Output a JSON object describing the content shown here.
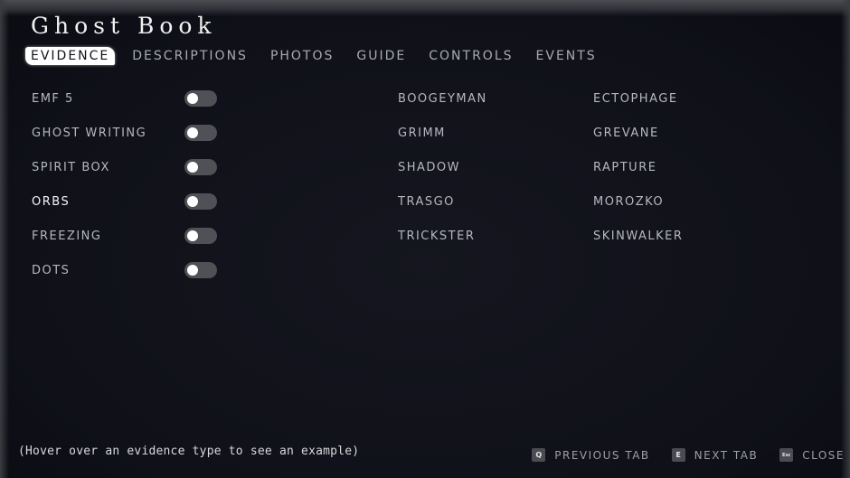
{
  "app": {
    "title": "Ghost Book"
  },
  "tabs": [
    {
      "label": "EVIDENCE",
      "active": true
    },
    {
      "label": "DESCRIPTIONS",
      "active": false
    },
    {
      "label": "PHOTOS",
      "active": false
    },
    {
      "label": "GUIDE",
      "active": false
    },
    {
      "label": "CONTROLS",
      "active": false
    },
    {
      "label": "EVENTS",
      "active": false
    }
  ],
  "evidence": [
    {
      "label": "EMF 5",
      "enabled": false
    },
    {
      "label": "GHOST WRITING",
      "enabled": false
    },
    {
      "label": "SPIRIT BOX",
      "enabled": false
    },
    {
      "label": "ORBS",
      "enabled": false,
      "highlighted": true
    },
    {
      "label": "FREEZING",
      "enabled": false
    },
    {
      "label": "DOTS",
      "enabled": false
    }
  ],
  "ghosts": {
    "column1": [
      "BOOGEYMAN",
      "GRIMM",
      "SHADOW",
      "TRASGO",
      "TRICKSTER"
    ],
    "column2": [
      "ECTOPHAGE",
      "GREVANE",
      "RAPTURE",
      "MOROZKO",
      "SKINWALKER"
    ]
  },
  "hint": "(Hover over an evidence type to see an example)",
  "footer": {
    "previous": {
      "key": "Q",
      "label": "PREVIOUS TAB"
    },
    "next": {
      "key": "E",
      "label": "NEXT TAB"
    },
    "close": {
      "key": "Esc",
      "label": "CLOSE"
    }
  },
  "colors": {
    "background": "#0f1018",
    "text": "#b5b8c0",
    "active_tab_bg": "#ffffff",
    "toggle_track": "#4f5157",
    "toggle_knob": "#ffffff"
  }
}
